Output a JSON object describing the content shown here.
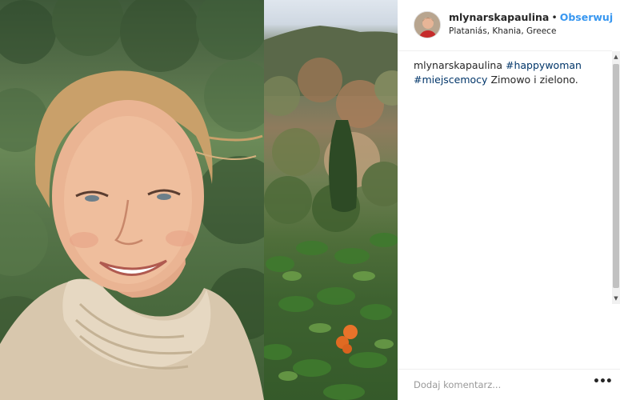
{
  "post": {
    "username": "mlynarskapaulina",
    "separator": "•",
    "follow_label": "Obserwuj",
    "location": "Plataniás, Khania, Greece"
  },
  "caption": {
    "username": "mlynarskapaulina",
    "hashtag_1": "#happywoman",
    "hashtag_2": "#miejscemocy",
    "text": "Zimowo i zielono."
  },
  "comment": {
    "placeholder": "Dodaj komentarz...",
    "more_label": "•••"
  },
  "scrollbar": {
    "up_glyph": "▲",
    "down_glyph": "▼"
  },
  "media": {
    "left_image": "portrait-in-turtleneck-photo",
    "right_image": "orange-grove-hills-photo"
  }
}
